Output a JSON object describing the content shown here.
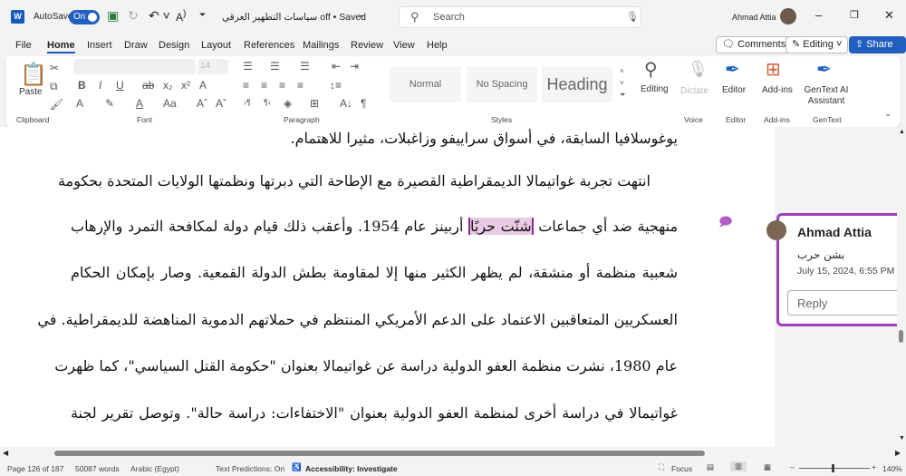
{
  "titlebar": {
    "autosave_label": "AutoSave",
    "autosave_state": "On",
    "doc_title": "سياسات التطهير العرقي off • Saved",
    "search_placeholder": "Search",
    "user": "Ahmad Attia"
  },
  "tabs": [
    "File",
    "Home",
    "Insert",
    "Draw",
    "Design",
    "Layout",
    "References",
    "Mailings",
    "Review",
    "View",
    "Help"
  ],
  "actions": {
    "comments": "Comments",
    "editing": "Editing",
    "share": "Share"
  },
  "ribbon": {
    "clipboard": {
      "paste": "Paste",
      "label": "Clipboard"
    },
    "font": {
      "size": "14",
      "label": "Font"
    },
    "paragraph": {
      "label": "Paragraph"
    },
    "styles": {
      "items": [
        "Normal",
        "No Spacing",
        "Heading"
      ],
      "label": "Styles"
    },
    "editing": {
      "label": "Editing"
    },
    "voice": {
      "dictate": "Dictate",
      "label": "Voice"
    },
    "editor": {
      "button": "Editor",
      "label": "Editor"
    },
    "addins": {
      "button": "Add-ins",
      "label": "Add-ins"
    },
    "gentext": {
      "button": "GenText AI Assistant",
      "label": "GenText"
    }
  },
  "document": {
    "lines": [
      "يوغوسلافيا السابقة، في أسواق سراييفو وزاغبلات، مثيرا للاهتمام.",
      "انتهت تجربة غواتيمالا الديمقراطية القصيرة مع الإطاحة التي دبرتها ونظمتها الولايات المتحدة بحكومة",
      "أربينز عام 1954. وأعقب ذلك قيام دولة لمكافحة التمرد والإرهاب",
      "شنّت حربًا",
      "منهجية ضد أي جماعات",
      "شعبية منظمة أو منشقة، لم يظهر الكثير منها إلا لمقاومة بطش الدولة القمعية. وصار بإمكان الحكام",
      "العسكريين المتعاقبين الاعتماد على الدعم الأمريكي المنتظم في حملاتهم الدموية المناهضة للديمقراطية. في",
      "عام 1980، نشرت منظمة العفو الدولية دراسة عن غواتيمالا بعنوان \"حكومة القتل السياسي\"، كما ظهرت",
      "غواتيمالا في دراسة أخرى لمنظمة العفو الدولية بعنوان \"الاختفاءات: دراسة حالة\". وتوصل تقرير لجنة"
    ]
  },
  "comment": {
    "author": "Ahmad Attia",
    "text": "بشن حرب",
    "date": "July 15, 2024, 6:55 PM",
    "reply_placeholder": "Reply"
  },
  "status": {
    "page": "Page 126 of 187",
    "words": "50087 words",
    "language": "Arabic (Egypt)",
    "predictions": "Text Predictions: On",
    "accessibility": "Accessibility: Investigate",
    "focus": "Focus",
    "zoom": "140%"
  },
  "colors": {
    "accent": "#1f5fbf",
    "comment": "#9b3fb5",
    "highlight": "#e9cbe6"
  }
}
